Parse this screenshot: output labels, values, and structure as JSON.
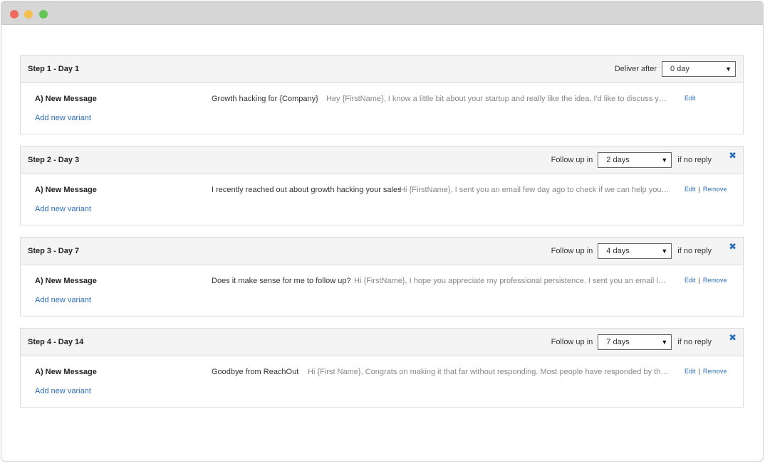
{
  "steps": [
    {
      "title": "Step 1 - Day 1",
      "control_label": "Deliver after",
      "select_value": "0 day",
      "suffix": "",
      "removable": false,
      "variant": "A) New Message",
      "subject": "Growth hacking for {Company}",
      "preview": "Hey {FirstName}, I know a little bit about your startup and really like the idea. I'd like to discuss your sales effor...",
      "edit": "Edit",
      "remove": "",
      "add_variant": "Add new variant"
    },
    {
      "title": "Step 2 - Day 3",
      "control_label": "Follow up in",
      "select_value": "2 days",
      "suffix": "if no reply",
      "removable": true,
      "variant": "A) New Message",
      "subject": "I recently reached out about growth hacking your sales",
      "preview": "Hi {FirstName}, I sent you an email few day ago to check if we can help you with growth...",
      "edit": "Edit",
      "remove": "Remove",
      "add_variant": "Add new variant"
    },
    {
      "title": "Step 3 - Day 7",
      "control_label": "Follow up in",
      "select_value": "4 days",
      "suffix": "if no reply",
      "removable": true,
      "variant": "A) New Message",
      "subject": "Does it make sense for me to follow up?",
      "preview": "Hi {FirstName}, I hope you appreciate my professional persistence. I sent you an email last week to se...",
      "edit": "Edit",
      "remove": "Remove",
      "add_variant": "Add new variant"
    },
    {
      "title": "Step 4 - Day 14",
      "control_label": "Follow up in",
      "select_value": "7 days",
      "suffix": "if no reply",
      "removable": true,
      "variant": "A) New Message",
      "subject": "Goodbye from ReachOut",
      "preview": "Hi {First Name}, Congrats on making it that far without responding. Most people have responded by then, that's the ...",
      "edit": "Edit",
      "remove": "Remove",
      "add_variant": "Add new variant"
    }
  ],
  "icons": {
    "close": "close-icon",
    "dropdown": "chevron-down-icon"
  },
  "colors": {
    "link": "#2a6ebb",
    "header_bg": "#f4f4f4",
    "border": "#dcdcdc"
  }
}
